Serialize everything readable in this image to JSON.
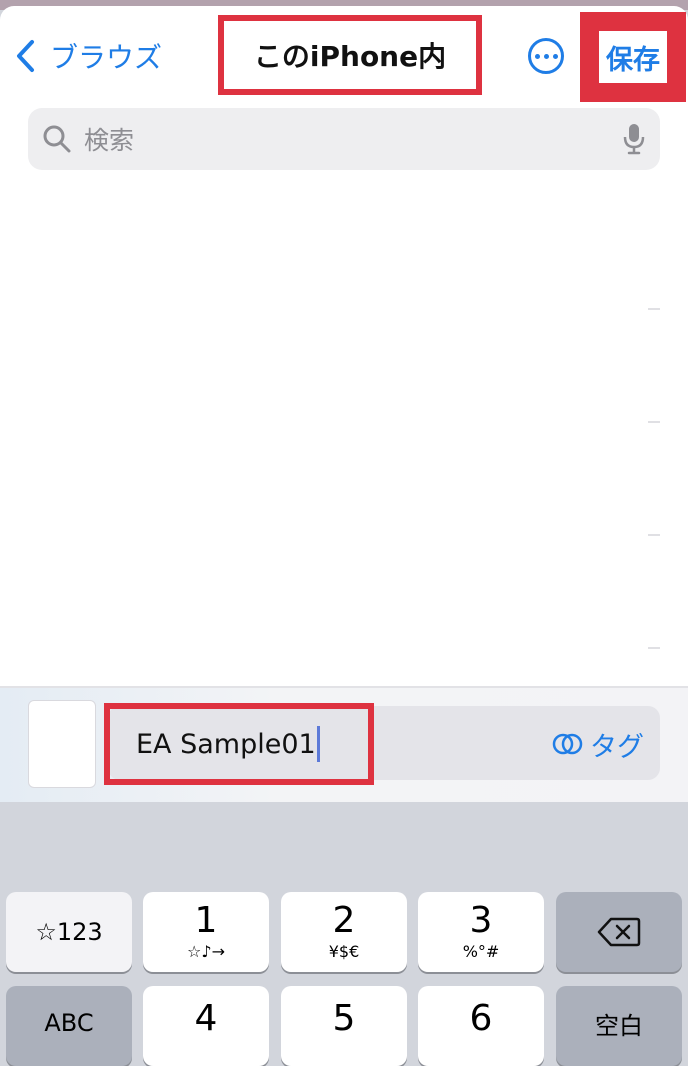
{
  "header": {
    "back_label": "ブラウズ",
    "title": "このiPhone内",
    "more_icon": "ellipsis-circle-icon",
    "save_label": "保存"
  },
  "search": {
    "placeholder": "検索",
    "search_icon": "magnifier-icon",
    "mic_icon": "microphone-icon"
  },
  "filename": {
    "value": "EA Sample01",
    "tag_label": "タグ",
    "tag_icon": "tag-circles-icon"
  },
  "keyboard": {
    "mode_key": "☆123",
    "row1": [
      {
        "main": "1",
        "sub": "☆♪→"
      },
      {
        "main": "2",
        "sub": "¥$€"
      },
      {
        "main": "3",
        "sub": "%°#"
      }
    ],
    "delete_icon": "backspace-icon",
    "abc_key": "ABC",
    "row2": [
      {
        "main": "4"
      },
      {
        "main": "5"
      },
      {
        "main": "6"
      }
    ],
    "space_key": "空白"
  },
  "colors": {
    "accent": "#1f7de6",
    "highlight": "#de3240"
  }
}
